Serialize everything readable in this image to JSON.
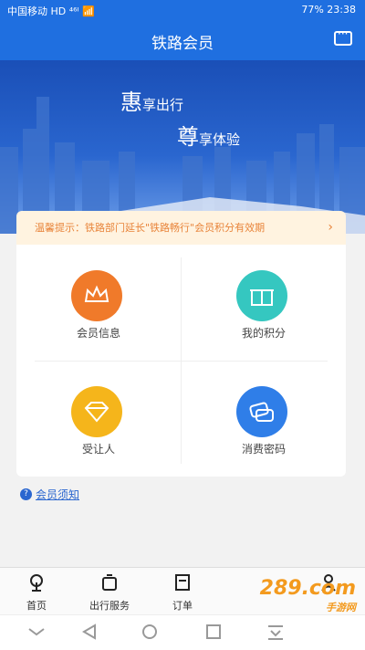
{
  "status_bar": {
    "left": "中国移动 HD ⁴⁶ᴵ 📶",
    "right": "77%  23:38"
  },
  "header": {
    "title": "铁路会员"
  },
  "hero": {
    "slogan_line1_char": "惠",
    "slogan_line1_rest": "享出行",
    "slogan_line2_char": "尊",
    "slogan_line2_rest": "享体验"
  },
  "notice": {
    "text": "温馨提示：铁路部门延长\"铁路畅行\"会员积分有效期"
  },
  "menu": [
    {
      "label": "会员信息",
      "icon": "crown-icon",
      "color": "#f07a2a"
    },
    {
      "label": "我的积分",
      "icon": "gift-icon",
      "color": "#35c7c0"
    },
    {
      "label": "受让人",
      "icon": "diamond-icon",
      "color": "#f5b51b"
    },
    {
      "label": "消费密码",
      "icon": "tickets-icon",
      "color": "#2f7ee8"
    }
  ],
  "member_notice_link": "会员须知",
  "tabs": [
    {
      "label": "首页",
      "icon": "railway-logo-icon"
    },
    {
      "label": "出行服务",
      "icon": "luggage-icon"
    },
    {
      "label": "订单",
      "icon": "order-icon"
    }
  ],
  "watermark": {
    "main": "289.com",
    "sub": "手游网"
  }
}
